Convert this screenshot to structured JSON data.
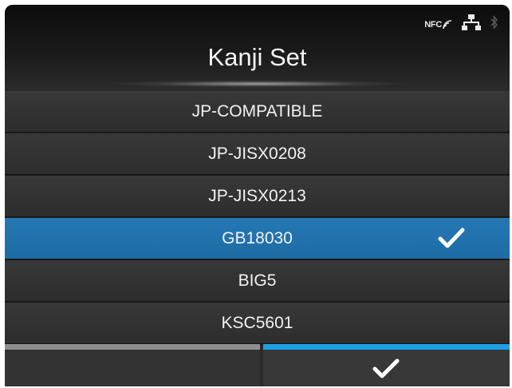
{
  "header": {
    "title": "Kanji Set",
    "status": {
      "nfc_label": "NFC"
    }
  },
  "options": [
    {
      "label": "JP-COMPATIBLE",
      "selected": false
    },
    {
      "label": "JP-JISX0208",
      "selected": false
    },
    {
      "label": "JP-JISX0213",
      "selected": false
    },
    {
      "label": "GB18030",
      "selected": true
    },
    {
      "label": "BIG5",
      "selected": false
    },
    {
      "label": "KSC5601",
      "selected": false
    }
  ],
  "footer": {
    "left_button_icon": "",
    "right_button_icon": "checkmark-icon"
  },
  "colors": {
    "selected": "#1e6ba4",
    "confirm_accent": "#1ea0e6",
    "back_accent": "#8e8e8e"
  }
}
